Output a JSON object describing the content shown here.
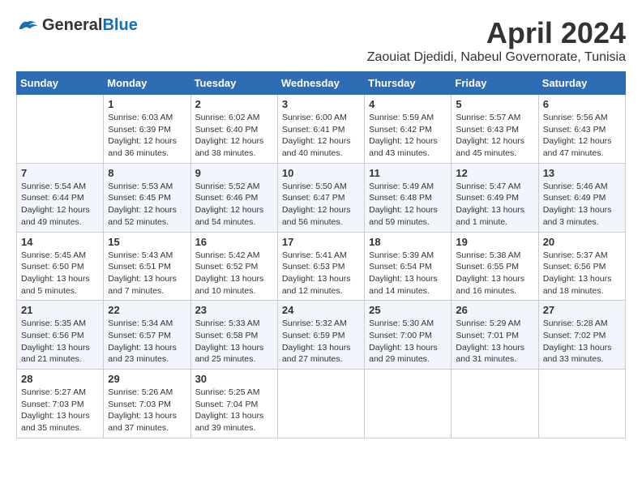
{
  "header": {
    "logo_general": "General",
    "logo_blue": "Blue",
    "month_title": "April 2024",
    "location": "Zaouiat Djedidi, Nabeul Governorate, Tunisia"
  },
  "days_of_week": [
    "Sunday",
    "Monday",
    "Tuesday",
    "Wednesday",
    "Thursday",
    "Friday",
    "Saturday"
  ],
  "weeks": [
    [
      {
        "day": "",
        "info": ""
      },
      {
        "day": "1",
        "info": "Sunrise: 6:03 AM\nSunset: 6:39 PM\nDaylight: 12 hours\nand 36 minutes."
      },
      {
        "day": "2",
        "info": "Sunrise: 6:02 AM\nSunset: 6:40 PM\nDaylight: 12 hours\nand 38 minutes."
      },
      {
        "day": "3",
        "info": "Sunrise: 6:00 AM\nSunset: 6:41 PM\nDaylight: 12 hours\nand 40 minutes."
      },
      {
        "day": "4",
        "info": "Sunrise: 5:59 AM\nSunset: 6:42 PM\nDaylight: 12 hours\nand 43 minutes."
      },
      {
        "day": "5",
        "info": "Sunrise: 5:57 AM\nSunset: 6:43 PM\nDaylight: 12 hours\nand 45 minutes."
      },
      {
        "day": "6",
        "info": "Sunrise: 5:56 AM\nSunset: 6:43 PM\nDaylight: 12 hours\nand 47 minutes."
      }
    ],
    [
      {
        "day": "7",
        "info": "Sunrise: 5:54 AM\nSunset: 6:44 PM\nDaylight: 12 hours\nand 49 minutes."
      },
      {
        "day": "8",
        "info": "Sunrise: 5:53 AM\nSunset: 6:45 PM\nDaylight: 12 hours\nand 52 minutes."
      },
      {
        "day": "9",
        "info": "Sunrise: 5:52 AM\nSunset: 6:46 PM\nDaylight: 12 hours\nand 54 minutes."
      },
      {
        "day": "10",
        "info": "Sunrise: 5:50 AM\nSunset: 6:47 PM\nDaylight: 12 hours\nand 56 minutes."
      },
      {
        "day": "11",
        "info": "Sunrise: 5:49 AM\nSunset: 6:48 PM\nDaylight: 12 hours\nand 59 minutes."
      },
      {
        "day": "12",
        "info": "Sunrise: 5:47 AM\nSunset: 6:49 PM\nDaylight: 13 hours\nand 1 minute."
      },
      {
        "day": "13",
        "info": "Sunrise: 5:46 AM\nSunset: 6:49 PM\nDaylight: 13 hours\nand 3 minutes."
      }
    ],
    [
      {
        "day": "14",
        "info": "Sunrise: 5:45 AM\nSunset: 6:50 PM\nDaylight: 13 hours\nand 5 minutes."
      },
      {
        "day": "15",
        "info": "Sunrise: 5:43 AM\nSunset: 6:51 PM\nDaylight: 13 hours\nand 7 minutes."
      },
      {
        "day": "16",
        "info": "Sunrise: 5:42 AM\nSunset: 6:52 PM\nDaylight: 13 hours\nand 10 minutes."
      },
      {
        "day": "17",
        "info": "Sunrise: 5:41 AM\nSunset: 6:53 PM\nDaylight: 13 hours\nand 12 minutes."
      },
      {
        "day": "18",
        "info": "Sunrise: 5:39 AM\nSunset: 6:54 PM\nDaylight: 13 hours\nand 14 minutes."
      },
      {
        "day": "19",
        "info": "Sunrise: 5:38 AM\nSunset: 6:55 PM\nDaylight: 13 hours\nand 16 minutes."
      },
      {
        "day": "20",
        "info": "Sunrise: 5:37 AM\nSunset: 6:56 PM\nDaylight: 13 hours\nand 18 minutes."
      }
    ],
    [
      {
        "day": "21",
        "info": "Sunrise: 5:35 AM\nSunset: 6:56 PM\nDaylight: 13 hours\nand 21 minutes."
      },
      {
        "day": "22",
        "info": "Sunrise: 5:34 AM\nSunset: 6:57 PM\nDaylight: 13 hours\nand 23 minutes."
      },
      {
        "day": "23",
        "info": "Sunrise: 5:33 AM\nSunset: 6:58 PM\nDaylight: 13 hours\nand 25 minutes."
      },
      {
        "day": "24",
        "info": "Sunrise: 5:32 AM\nSunset: 6:59 PM\nDaylight: 13 hours\nand 27 minutes."
      },
      {
        "day": "25",
        "info": "Sunrise: 5:30 AM\nSunset: 7:00 PM\nDaylight: 13 hours\nand 29 minutes."
      },
      {
        "day": "26",
        "info": "Sunrise: 5:29 AM\nSunset: 7:01 PM\nDaylight: 13 hours\nand 31 minutes."
      },
      {
        "day": "27",
        "info": "Sunrise: 5:28 AM\nSunset: 7:02 PM\nDaylight: 13 hours\nand 33 minutes."
      }
    ],
    [
      {
        "day": "28",
        "info": "Sunrise: 5:27 AM\nSunset: 7:03 PM\nDaylight: 13 hours\nand 35 minutes."
      },
      {
        "day": "29",
        "info": "Sunrise: 5:26 AM\nSunset: 7:03 PM\nDaylight: 13 hours\nand 37 minutes."
      },
      {
        "day": "30",
        "info": "Sunrise: 5:25 AM\nSunset: 7:04 PM\nDaylight: 13 hours\nand 39 minutes."
      },
      {
        "day": "",
        "info": ""
      },
      {
        "day": "",
        "info": ""
      },
      {
        "day": "",
        "info": ""
      },
      {
        "day": "",
        "info": ""
      }
    ]
  ]
}
